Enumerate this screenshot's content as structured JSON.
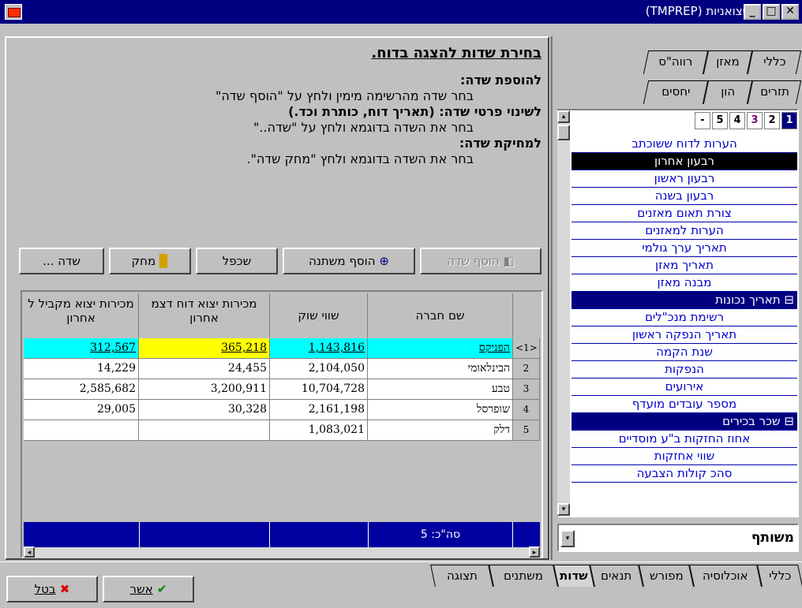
{
  "window": {
    "title": "יצואניות (TMPREP)",
    "close": "✕",
    "maximize": "□",
    "minimize": "_"
  },
  "left": {
    "heading": "בחירת שדות להצגה בדוח.",
    "instructions": [
      {
        "text": "להוספת שדה:",
        "bold": true
      },
      {
        "text": "בחר שדה מהרשימה מימין ולחץ על \"הוסף שדה\"",
        "bold": false
      },
      {
        "text": "לשינוי פרטי שדה: (תאריך דוח, כותרת וכד.)",
        "bold": true
      },
      {
        "text": "בחר את השדה בדוגמא ולחץ על \"שדה..\"",
        "bold": false
      },
      {
        "text": "למחיקת שדה:",
        "bold": true
      },
      {
        "text": "בחר את השדה בדוגמא ולחץ \"מחק שדה\".",
        "bold": false
      }
    ],
    "buttons": {
      "add_field": "הוסף שדה",
      "add_variable": "הוסף משתנה",
      "duplicate": "שכפל",
      "delete": "מחק",
      "field": "שדה ..."
    },
    "table": {
      "headers": [
        "שם חברה",
        "שווי שוק",
        "מכירות יצוא דוח דצמ אחרון",
        "מכירות יצוא מקביל ל אחרון"
      ],
      "rows": [
        {
          "num": "<1>",
          "name": "הפניקס",
          "mv": "1,143,816",
          "s1": "365,218",
          "s2": "312,567"
        },
        {
          "num": "2",
          "name": "הבינלאומי",
          "mv": "2,104,050",
          "s1": "24,455",
          "s2": "14,229"
        },
        {
          "num": "3",
          "name": "טבע",
          "mv": "10,704,728",
          "s1": "3,200,911",
          "s2": "2,585,682"
        },
        {
          "num": "4",
          "name": "שופרסל",
          "mv": "2,161,198",
          "s1": "30,328",
          "s2": "29,005"
        },
        {
          "num": "5",
          "name": "דלק",
          "mv": "1,083,021",
          "s1": "",
          "s2": ""
        }
      ],
      "footer_total": "סה\"כ: 5"
    }
  },
  "right": {
    "tabs_row1": [
      "כללי",
      "מאזן",
      "רווה\"ס"
    ],
    "tabs_row2": [
      "תזרים",
      "הון",
      "יחסים"
    ],
    "pages": [
      "1",
      "2",
      "3",
      "4",
      "5",
      "-"
    ],
    "list": [
      {
        "label": "הערות לדוח ששוכתב",
        "type": "item"
      },
      {
        "label": "רבעון אחרון",
        "type": "sel"
      },
      {
        "label": "רבעון ראשון",
        "type": "item"
      },
      {
        "label": "רבעון בשנה",
        "type": "item"
      },
      {
        "label": "צורת תאום מאזנים",
        "type": "item"
      },
      {
        "label": "הערות למאזנים",
        "type": "item"
      },
      {
        "label": "תאריך ערך גולמי",
        "type": "item"
      },
      {
        "label": "תאריך מאזן",
        "type": "item"
      },
      {
        "label": "מבנה מאזן",
        "type": "item"
      },
      {
        "label": "תאריך נכונות",
        "type": "grp"
      },
      {
        "label": "רשימת מנכ\"לים",
        "type": "item"
      },
      {
        "label": "תאריך הנפקה ראשון",
        "type": "item"
      },
      {
        "label": "שנת הקמה",
        "type": "item"
      },
      {
        "label": "הנפקות",
        "type": "item"
      },
      {
        "label": "אירועים",
        "type": "item"
      },
      {
        "label": "מספר עובדים מועדף",
        "type": "item"
      },
      {
        "label": "שכר בכירים",
        "type": "grp"
      },
      {
        "label": "אחוז החזקות ב\"ע מוסדיים",
        "type": "item"
      },
      {
        "label": "שווי אחזקות",
        "type": "item"
      },
      {
        "label": "סהכ קולות הצבעה",
        "type": "item"
      }
    ],
    "combo_value": "משותף"
  },
  "bottom": {
    "tabs": [
      "כללי",
      "אוכלוסיה",
      "מפורש",
      "תנאים",
      "שדות",
      "משתנים",
      "תצוגה"
    ],
    "ok": "אשר",
    "cancel": "בטל"
  },
  "colors": {
    "title": "#000080",
    "cyan": "#00ffff",
    "yellow": "#ffff00",
    "navy": "#000080"
  }
}
